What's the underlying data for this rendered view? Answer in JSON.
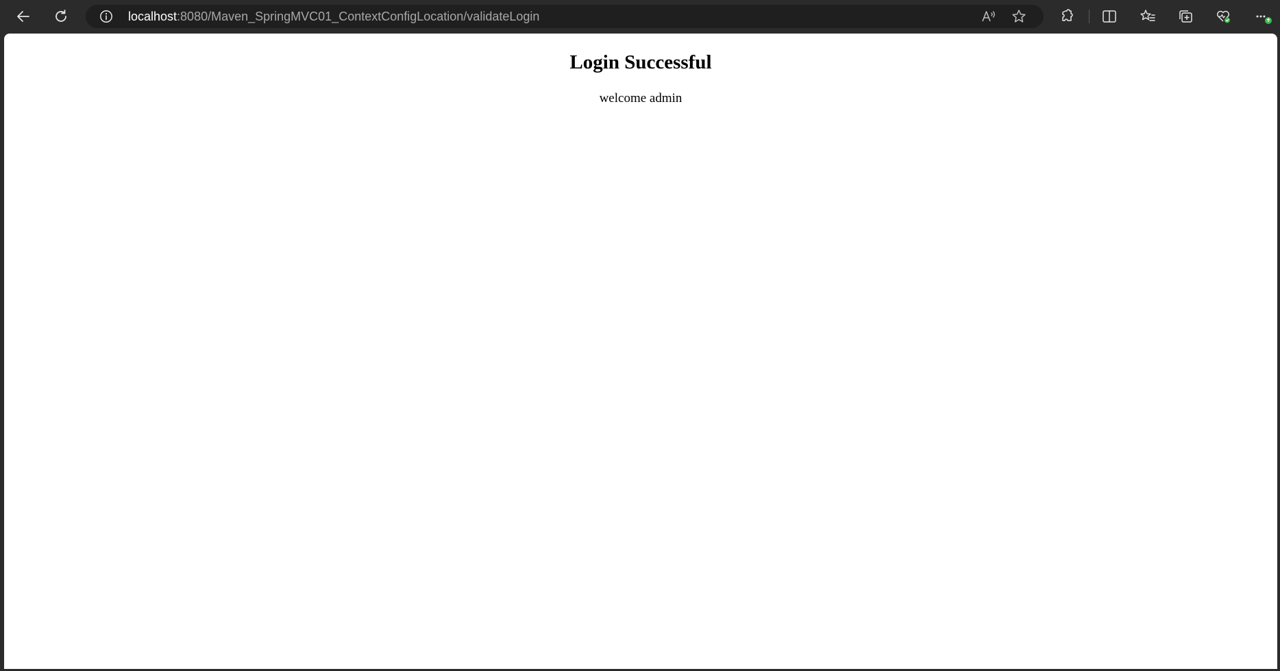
{
  "browser": {
    "address_bar": {
      "host": "localhost",
      "path": ":8080/Maven_SpringMVC01_ContextConfigLocation/validateLogin"
    },
    "toolbar_icons": [
      "back-icon",
      "refresh-icon",
      "site-info-icon",
      "read-aloud-icon",
      "favorite-star-icon",
      "extensions-icon",
      "split-screen-icon",
      "favorites-icon",
      "collections-icon",
      "browser-essentials-icon",
      "more-icon"
    ],
    "colors": {
      "chrome_bg": "#2b2b2b",
      "address_bg": "#1f1f1f",
      "badge_green": "#3fb950"
    }
  },
  "page": {
    "heading": "Login Successful",
    "message": "welcome admin"
  }
}
